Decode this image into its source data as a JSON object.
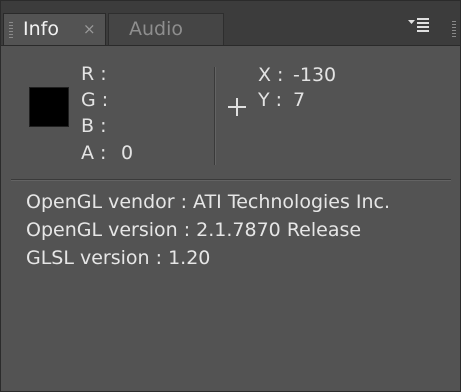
{
  "tabs": [
    {
      "label": "Info",
      "active": true
    },
    {
      "label": "Audio",
      "active": false
    }
  ],
  "tab_close_glyph": "×",
  "icons": {
    "close": "close-icon",
    "panel_menu": "panel-menu-icon",
    "crosshair": "crosshair-icon"
  },
  "color_readout": {
    "swatch_color": "#000000",
    "r_label": "R :",
    "g_label": "G :",
    "b_label": "B :",
    "a_label": "A :",
    "a_value": "0"
  },
  "position_readout": {
    "x_label": "X :",
    "x_value": "-130",
    "y_label": "Y :",
    "y_value": "7"
  },
  "gl_info": [
    "OpenGL vendor : ATI Technologies Inc.",
    "OpenGL version : 2.1.7870 Release",
    "GLSL version : 1.20"
  ],
  "colors": {
    "panel_bg": "#535353",
    "tabbar_bg": "#3c3c3c",
    "text": "#e3e3e3"
  }
}
